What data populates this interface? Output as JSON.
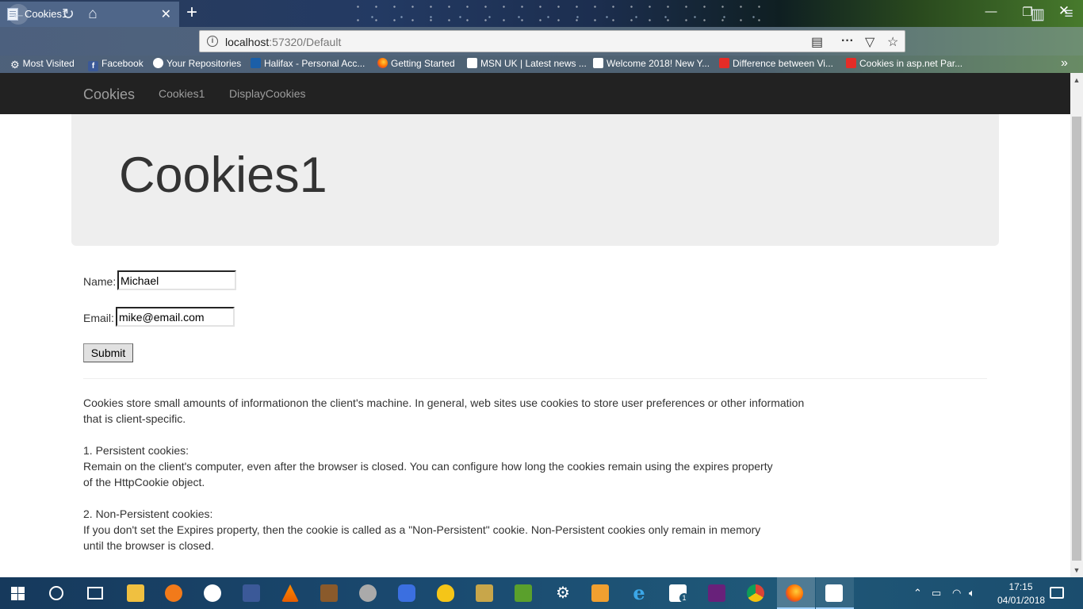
{
  "browser": {
    "tab_title": "Cookies1",
    "url_host": "localhost",
    "url_rest": ":57320/Default",
    "bookmarks": [
      {
        "label": "Most Visited",
        "icon": "gear-icon"
      },
      {
        "label": "Facebook",
        "icon": "facebook-icon"
      },
      {
        "label": "Your Repositories",
        "icon": "github-icon"
      },
      {
        "label": "Halifax - Personal Acc...",
        "icon": "halifax-icon"
      },
      {
        "label": "Getting Started",
        "icon": "firefox-icon"
      },
      {
        "label": "MSN UK | Latest news ...",
        "icon": "msn-icon"
      },
      {
        "label": "Welcome 2018! New Y...",
        "icon": "msn-icon"
      },
      {
        "label": "Difference between Vi...",
        "icon": "youtube-icon"
      },
      {
        "label": "Cookies in asp.net Par...",
        "icon": "youtube-icon"
      }
    ]
  },
  "site": {
    "brand": "Cookies",
    "nav": [
      "Cookies1",
      "DisplayCookies"
    ],
    "page_title": "Cookies1"
  },
  "form": {
    "name_label": "Name:",
    "name_value": "Michael",
    "email_label": "Email:",
    "email_value": "mike@email.com",
    "submit_label": "Submit"
  },
  "content": {
    "intro_line1": "Cookies store small amounts of informationon the client's machine. In general, web sites use cookies to store user preferences or other information",
    "intro_line2": "that is client-specific.",
    "persistent_heading": "1. Persistent cookies:",
    "persistent_line1": "Remain on the client's computer, even after the browser is closed. You can configure how long the cookies remain using the expires property",
    "persistent_line2": "of the HttpCookie object.",
    "nonpersistent_heading": "2. Non-Persistent cookies:",
    "nonpersistent_line1": "If you don't set the Expires property, then the cookie is called as a \"Non-Persistent\" cookie. Non-Persistent cookies only remain in memory",
    "nonpersistent_line2": "until the browser is closed."
  },
  "taskbar": {
    "time": "17:15",
    "date": "04/01/2018",
    "mail_badge": "1"
  }
}
